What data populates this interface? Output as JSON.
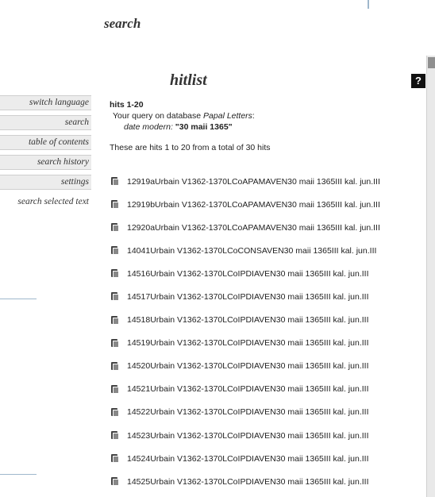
{
  "header": {
    "title": "search"
  },
  "sidebar": {
    "items": [
      {
        "label": "switch language"
      },
      {
        "label": "search"
      },
      {
        "label": "table of contents"
      },
      {
        "label": "search history"
      },
      {
        "label": "settings"
      },
      {
        "label": "search selected text"
      }
    ]
  },
  "main": {
    "title": "hitlist",
    "help_label": "?",
    "hits_range": "hits 1-20",
    "query_prefix": "Your query on database ",
    "database": "Papal Letters",
    "query_suffix": ":",
    "criteria_key": "date modern: ",
    "criteria_value": "\"30 maii 1365\"",
    "summary": "These are hits 1 to 20 from a total of 30 hits",
    "hits": [
      "12919aUrbain V1362-1370LCoAPAMAVEN30 maii 1365III kal. jun.III",
      "12919bUrbain V1362-1370LCoAPAMAVEN30 maii 1365III kal. jun.III",
      "12920aUrbain V1362-1370LCoAPAMAVEN30 maii 1365III kal. jun.III",
      "14041Urbain V1362-1370LCoCONSAVEN30 maii 1365III kal. jun.III",
      "14516Urbain V1362-1370LCoIPDIAVEN30 maii 1365III kal. jun.III",
      "14517Urbain V1362-1370LCoIPDIAVEN30 maii 1365III kal. jun.III",
      "14518Urbain V1362-1370LCoIPDIAVEN30 maii 1365III kal. jun.III",
      "14519Urbain V1362-1370LCoIPDIAVEN30 maii 1365III kal. jun.III",
      "14520Urbain V1362-1370LCoIPDIAVEN30 maii 1365III kal. jun.III",
      "14521Urbain V1362-1370LCoIPDIAVEN30 maii 1365III kal. jun.III",
      "14522Urbain V1362-1370LCoIPDIAVEN30 maii 1365III kal. jun.III",
      "14523Urbain V1362-1370LCoIPDIAVEN30 maii 1365III kal. jun.III",
      "14524Urbain V1362-1370LCoIPDIAVEN30 maii 1365III kal. jun.III",
      "14525Urbain V1362-1370LCoIPDIAVEN30 maii 1365III kal. jun.III"
    ]
  },
  "colors": {
    "accent_line": "#9fb7cc",
    "help_bg": "#111111"
  }
}
